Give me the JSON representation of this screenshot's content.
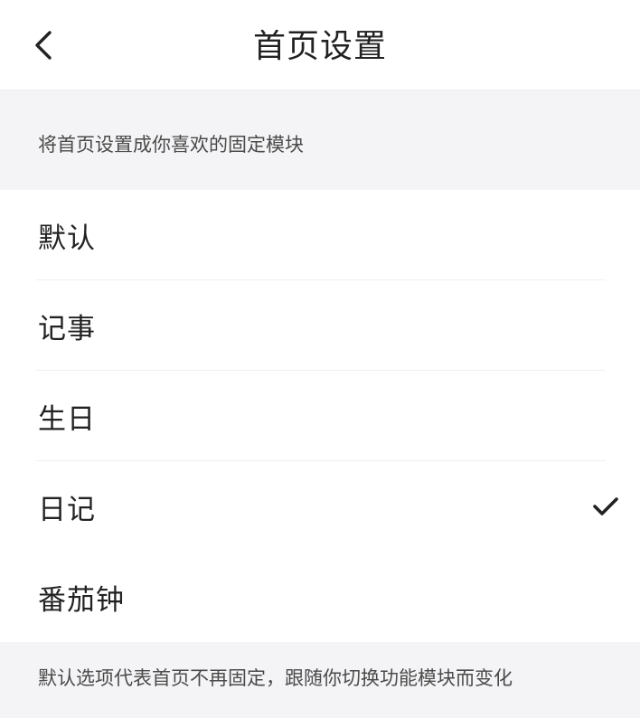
{
  "header": {
    "title": "首页设置",
    "back_icon": "chevron-left-icon"
  },
  "hint_top": "将首页设置成你喜欢的固定模块",
  "options": [
    {
      "id": "default",
      "label": "默认",
      "selected": false
    },
    {
      "id": "notes",
      "label": "记事",
      "selected": false
    },
    {
      "id": "birthday",
      "label": "生日",
      "selected": false
    },
    {
      "id": "diary",
      "label": "日记",
      "selected": true
    },
    {
      "id": "pomodoro",
      "label": "番茄钟",
      "selected": false
    }
  ],
  "check_icon": "checkmark-icon",
  "hint_bottom": "默认选项代表首页不再固定，跟随你切换功能模块而变化",
  "colors": {
    "background": "#ffffff",
    "section_background": "#f4f4f6",
    "text": "#222222",
    "hint_text": "#4a4a4a"
  }
}
